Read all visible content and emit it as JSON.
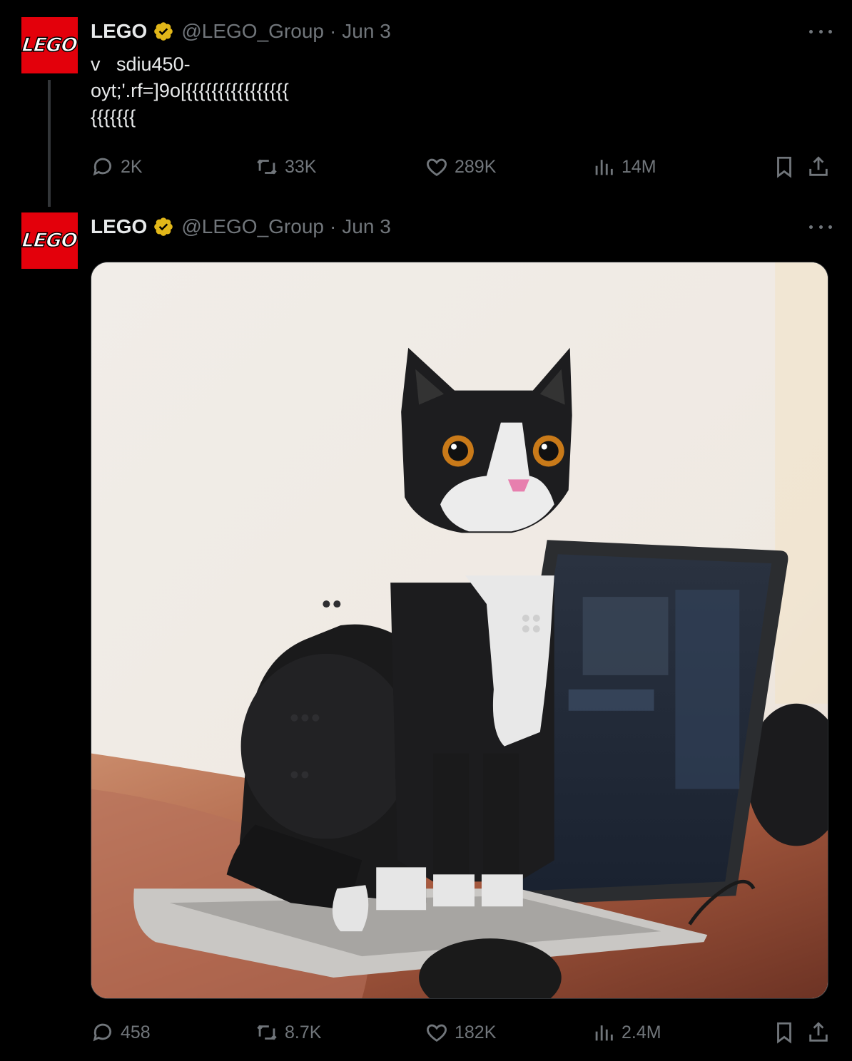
{
  "tweets": [
    {
      "author": {
        "name": "LEGO",
        "handle": "@LEGO_Group",
        "date": "Jun 3",
        "logo_text": "LEGO"
      },
      "text": "v   sdiu450-\noyt;'.rf=]9o[{{{{{{{{{{{{{{{{\n{{{{{{{",
      "stats": {
        "replies": "2K",
        "reposts": "33K",
        "likes": "289K",
        "views": "14M"
      }
    },
    {
      "author": {
        "name": "LEGO",
        "handle": "@LEGO_Group",
        "date": "Jun 3",
        "logo_text": "LEGO"
      },
      "stats": {
        "replies": "458",
        "reposts": "8.7K",
        "likes": "182K",
        "views": "2.4M"
      }
    }
  ],
  "icons": {
    "verified": "verified-badge-icon",
    "more": "more-icon",
    "reply": "reply-icon",
    "repost": "repost-icon",
    "like": "like-icon",
    "views": "views-icon",
    "bookmark": "bookmark-icon",
    "share": "share-icon"
  },
  "colors": {
    "background": "#000000",
    "text": "#e7e9ea",
    "muted": "#71767b",
    "verified_gold": "#e2b719",
    "lego_red": "#e3000b"
  }
}
